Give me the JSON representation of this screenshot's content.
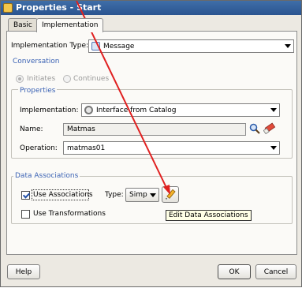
{
  "window": {
    "title": "Properties - Start"
  },
  "tabs": [
    {
      "label": "Basic"
    },
    {
      "label": "Implementation"
    }
  ],
  "implementation_type": {
    "label": "Implementation Type:",
    "value": "Message",
    "icon": "message-icon"
  },
  "conversation": {
    "section_label": "Conversation",
    "initiates_label": "Initiates",
    "continues_label": "Continues",
    "selected": "Initiates"
  },
  "properties": {
    "section_label": "Properties",
    "implementation_label": "Implementation:",
    "implementation_value": "Interface from Catalog",
    "name_label": "Name:",
    "name_value": "Matmas",
    "operation_label": "Operation:",
    "operation_value": "matmas01"
  },
  "data_associations": {
    "section_label": "Data Associations",
    "use_associations_label": "Use Associations",
    "use_associations_checked": true,
    "type_label": "Type:",
    "type_value": "Simple",
    "use_transformations_label": "Use Transformations",
    "use_transformations_checked": false,
    "tooltip": "Edit Data Associations"
  },
  "footer": {
    "help_label": "Help",
    "ok_label": "OK",
    "cancel_label": "Cancel"
  },
  "colors": {
    "title_bar": "#2f5e9c",
    "section_label": "#3a62b4",
    "annotation_arrow": "#e02020"
  }
}
